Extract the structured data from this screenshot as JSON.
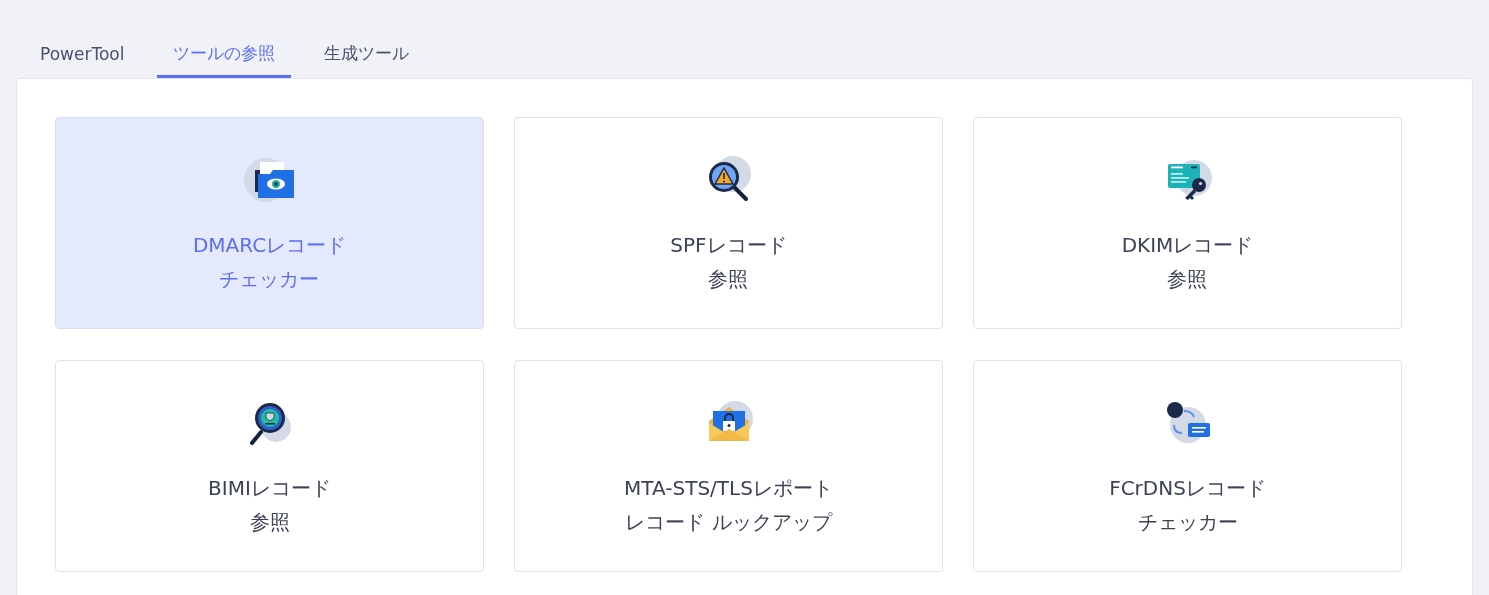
{
  "tabs": [
    {
      "label": "PowerTool",
      "selected": false
    },
    {
      "label": "ツールの参照",
      "selected": true
    },
    {
      "label": "生成ツール",
      "selected": false
    }
  ],
  "tools": [
    {
      "lines": [
        "DMARCレコード",
        "チェッカー"
      ],
      "selected": true
    },
    {
      "lines": [
        "SPFレコード",
        "参照"
      ],
      "selected": false
    },
    {
      "lines": [
        "DKIMレコード",
        "参照"
      ],
      "selected": false
    },
    {
      "lines": [
        "BIMIレコード",
        "参照"
      ],
      "selected": false
    },
    {
      "lines": [
        "MTA-STS/TLSレポート",
        "レコード ルックアップ"
      ],
      "selected": false
    },
    {
      "lines": [
        "FCrDNSレコード",
        "チェッカー"
      ],
      "selected": false
    }
  ]
}
